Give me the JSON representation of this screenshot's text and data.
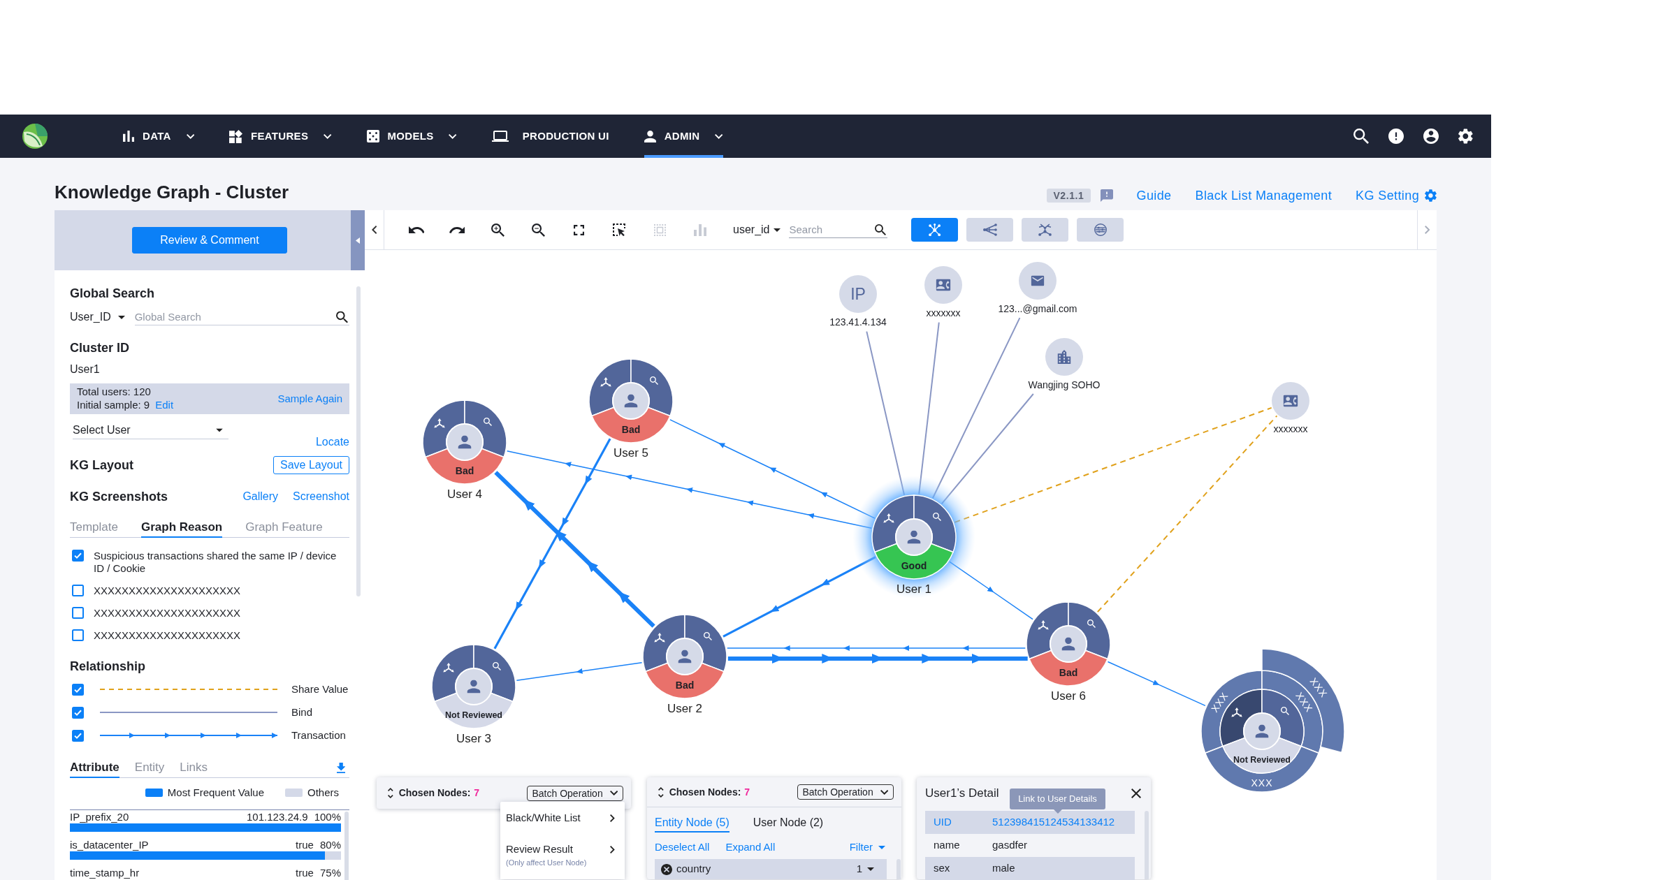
{
  "navbar": {
    "items": [
      {
        "label": "DATA",
        "menu": true,
        "selected": false
      },
      {
        "label": "FEATURES",
        "menu": true,
        "selected": false
      },
      {
        "label": "MODELS",
        "menu": true,
        "selected": false
      },
      {
        "label": "PRODUCTION UI",
        "menu": false,
        "selected": false
      },
      {
        "label": "ADMIN",
        "menu": true,
        "selected": true
      }
    ]
  },
  "header": {
    "title": "Knowledge Graph - Cluster",
    "version": "V2.1.1",
    "links": [
      "Guide",
      "Black List Management",
      "KG Setting"
    ]
  },
  "sidebar": {
    "review_button": "Review & Comment",
    "global_search": {
      "title": "Global Search",
      "field": "User_ID",
      "placeholder": "Global Search"
    },
    "cluster": {
      "title": "Cluster ID",
      "value": "User1",
      "total": "Total users: 120",
      "sample": "Initial sample: 9",
      "edit": "Edit",
      "sample_again": "Sample Again",
      "select": {
        "placeholder": "Select User"
      },
      "locate": "Locate"
    },
    "layout": {
      "title": "KG Layout",
      "button": "Save Layout"
    },
    "screenshots": {
      "title": "KG Screenshots",
      "links": [
        "Gallery",
        "Screenshot"
      ]
    },
    "reason_tabs": [
      {
        "label": "Template",
        "selected": false
      },
      {
        "label": "Graph Reason",
        "selected": true
      },
      {
        "label": "Graph Feature",
        "selected": false
      }
    ],
    "reasons": [
      {
        "text": "Suspicious transactions shared the same IP / device ID / Cookie",
        "checked": true
      },
      {
        "text": "XXXXXXXXXXXXXXXXXXXXX",
        "checked": false
      },
      {
        "text": "XXXXXXXXXXXXXXXXXXXXX",
        "checked": false
      },
      {
        "text": "XXXXXXXXXXXXXXXXXXXXX",
        "checked": false
      }
    ],
    "relationship": {
      "title": "Relationship",
      "items": [
        {
          "kind": "share_value",
          "label": "Share Value",
          "color": "#e0a11b",
          "checked": true
        },
        {
          "kind": "bind",
          "label": "Bind",
          "color": "#8a97c4",
          "checked": true
        },
        {
          "kind": "transaction",
          "label": "Transaction",
          "color": "#1a82f7",
          "checked": true
        }
      ]
    },
    "attribute_tabs": [
      {
        "label": "Attribute",
        "selected": true
      },
      {
        "label": "Entity",
        "selected": false
      },
      {
        "label": "Links",
        "selected": false
      }
    ],
    "legend": [
      {
        "label": "Most Frequent Value",
        "color": "#0b80f7"
      },
      {
        "label": "Others",
        "color": "#d4d9e8"
      }
    ],
    "attributes": [
      {
        "name": "IP_prefix_20",
        "value": "101.123.24.9",
        "share": "100%",
        "level": 1
      },
      {
        "name": "is_datacenter_IP",
        "value": "true",
        "share": "80%",
        "level": 0.94
      },
      {
        "name": "time_stamp_hr",
        "value": "true",
        "share": "75%"
      }
    ]
  },
  "toolbar": {
    "tools": [
      {
        "disabled": false
      },
      {
        "disabled": false
      },
      {
        "disabled": false
      },
      {
        "disabled": false
      },
      {
        "disabled": false
      },
      {
        "disabled": false
      },
      {
        "disabled": true
      },
      {
        "disabled": true
      }
    ],
    "field": "user_id",
    "search": {
      "placeholder": "Search"
    },
    "layouts": [
      {
        "selected": true
      },
      {
        "selected": false
      },
      {
        "selected": false
      },
      {
        "selected": false
      }
    ]
  },
  "graph": {
    "entities": [
      {
        "kind": "ip",
        "glyph": "IP",
        "label": "123.41.4.134"
      },
      {
        "kind": "contact",
        "label": "xxxxxxx"
      },
      {
        "kind": "email",
        "label": "123...@gmail.com"
      },
      {
        "kind": "address",
        "label": "Wangjing SOHO"
      },
      {
        "kind": "contact",
        "label": "xxxxxxx"
      }
    ],
    "users": [
      {
        "label": "User 5",
        "status": {
          "label": "Bad",
          "color": "#e9716b"
        },
        "highlighted": false,
        "expanded": false
      },
      {
        "label": "User 4",
        "status": {
          "label": "Bad",
          "color": "#e9716b"
        },
        "highlighted": false,
        "expanded": false
      },
      {
        "label": "User 1",
        "status": {
          "label": "Good",
          "color": "#36c552"
        },
        "highlighted": true,
        "expanded": false
      },
      {
        "label": "User 6",
        "status": {
          "label": "Bad",
          "color": "#e9716b"
        },
        "highlighted": false,
        "expanded": false
      },
      {
        "label": "User 2",
        "status": {
          "label": "Bad",
          "color": "#e9716b"
        },
        "highlighted": false,
        "expanded": false
      },
      {
        "label": "User 3",
        "status": {
          "label": "Not Reviewed",
          "color": "#d5d9e8"
        },
        "highlighted": false,
        "expanded": false
      },
      {
        "status": {
          "label": "Not Reviewed",
          "color": "#d5d9e8"
        },
        "highlighted": false,
        "expanded": true,
        "rings": [
          [
            "XXX",
            "XXX",
            "XXX"
          ],
          [
            "XXX"
          ]
        ]
      }
    ],
    "edges": [
      {
        "kind": "bind"
      },
      {
        "kind": "bind"
      },
      {
        "kind": "bind"
      },
      {
        "kind": "bind"
      },
      {
        "kind": "share_value"
      },
      {
        "kind": "share_value"
      },
      {
        "kind": "transaction_light"
      },
      {
        "kind": "transaction_light"
      },
      {
        "kind": "transaction_heavy"
      },
      {
        "kind": "transaction_medium"
      },
      {
        "kind": "transaction_medium"
      },
      {
        "kind": "transaction_light"
      },
      {
        "kind": "transaction_light"
      },
      {
        "kind": "transaction_heavy"
      },
      {
        "kind": "transaction_light"
      },
      {
        "kind": "transaction_light"
      }
    ]
  },
  "chosen_nodes": [
    {
      "title": "Chosen Nodes:",
      "count": "7",
      "button": "Batch Operation",
      "menu": [
        {
          "label": "Black/White List"
        },
        {
          "label": "Review Result",
          "note": "(Only affect User Node)"
        }
      ]
    },
    {
      "title": "Chosen Nodes:",
      "count": "7",
      "button": "Batch Operation",
      "tabs": [
        {
          "label": "Entity Node (5)",
          "selected": true
        },
        {
          "label": "User Node (2)",
          "selected": false
        }
      ],
      "actions": [
        "Deselect All",
        "Expand All"
      ],
      "filter": "Filter",
      "rows": [
        {
          "label": "country",
          "count": "1"
        }
      ]
    }
  ],
  "detail": {
    "title": "User1’s Detail",
    "tooltip": "Link to User Details",
    "rows": [
      {
        "key": "UID",
        "value": "512398415124534133412",
        "selected": true
      },
      {
        "key": "name",
        "value": "gasdfer",
        "selected": false
      },
      {
        "key": "sex",
        "value": "male",
        "selected": false
      }
    ]
  }
}
